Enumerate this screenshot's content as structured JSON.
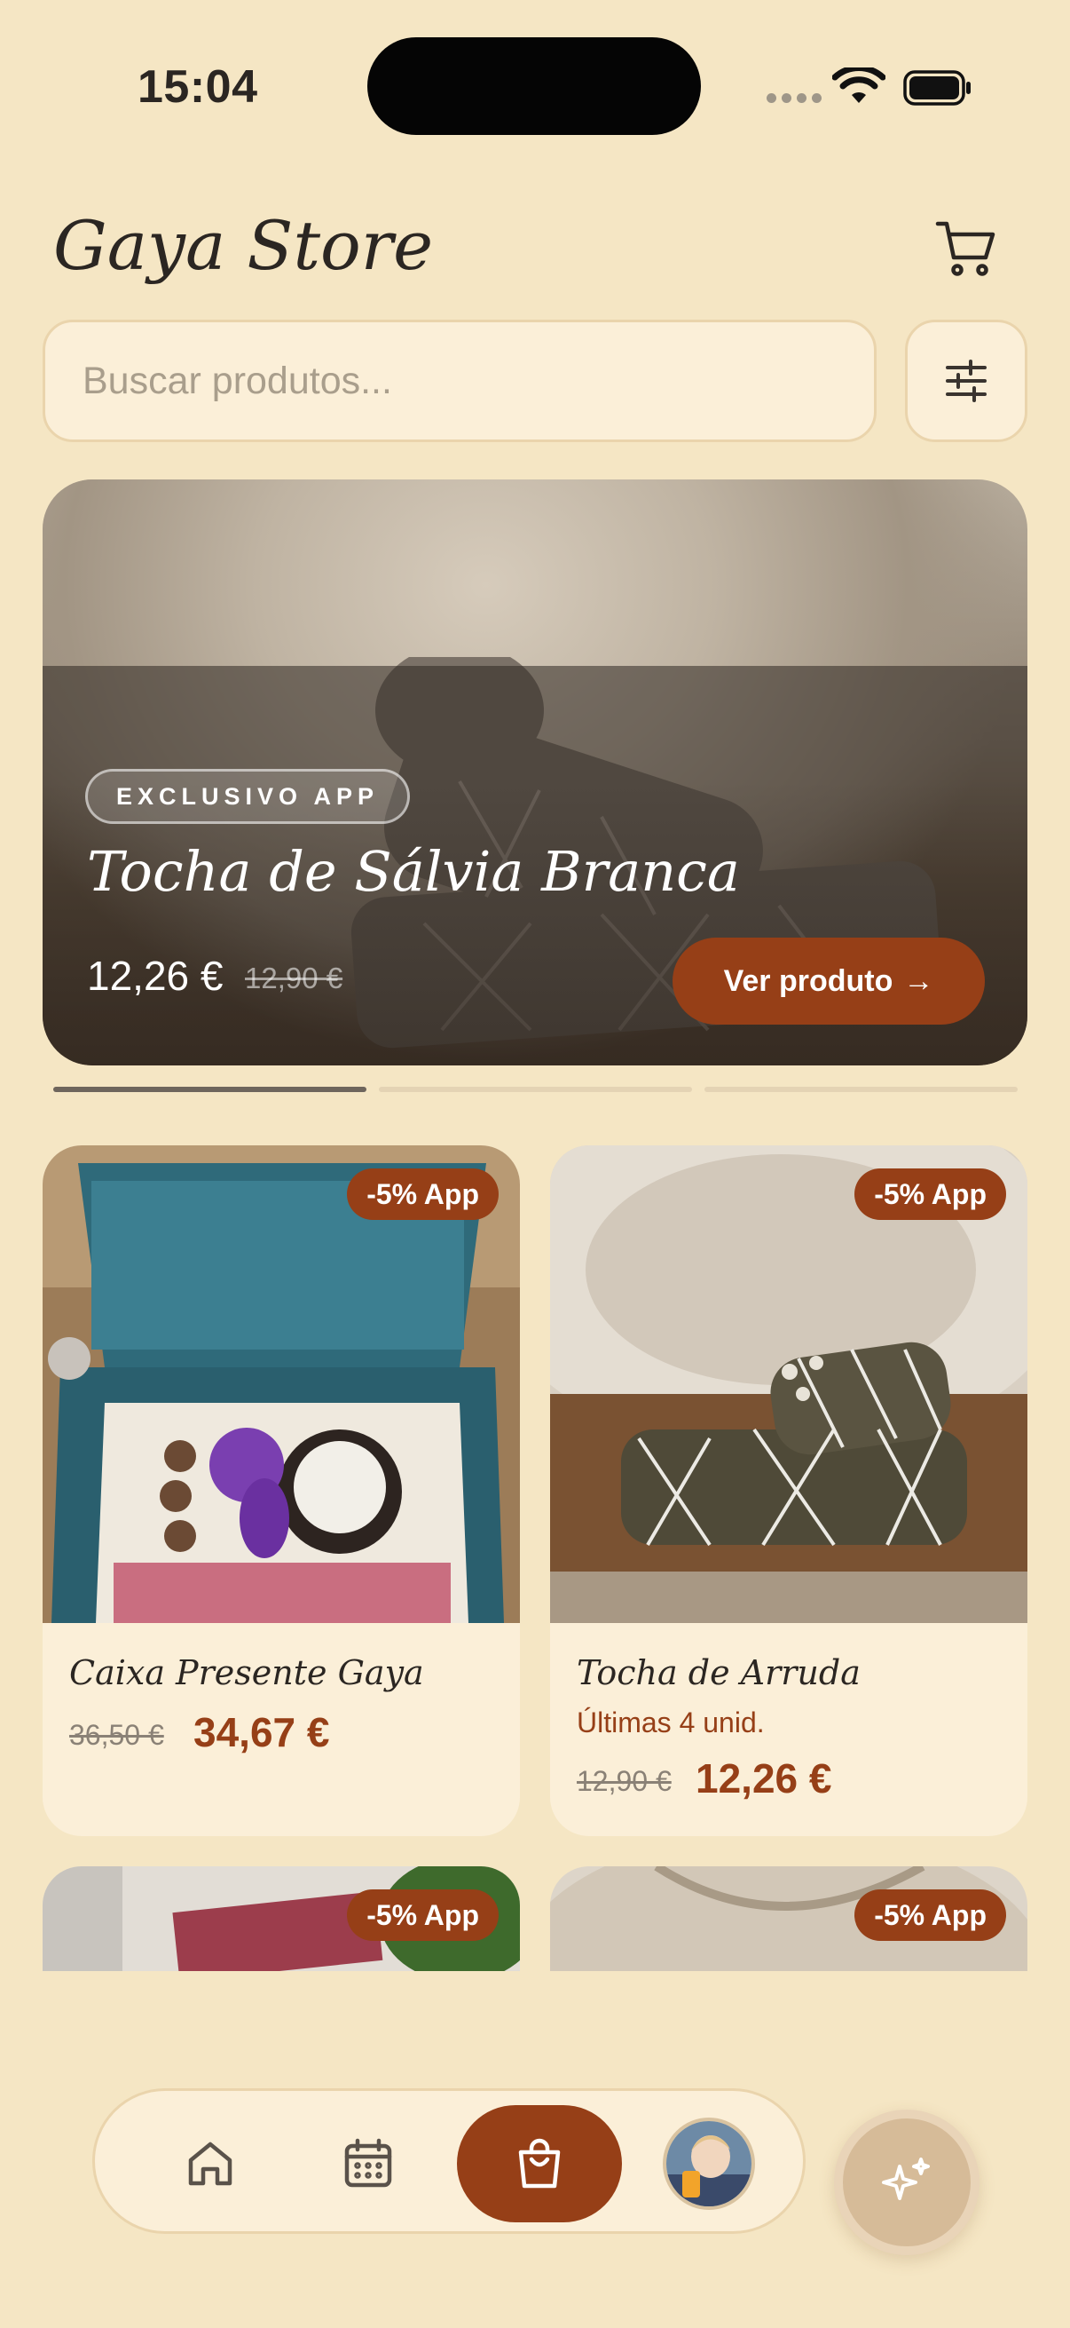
{
  "status_bar": {
    "time": "15:04"
  },
  "header": {
    "title": "Gaya Store"
  },
  "search": {
    "placeholder": "Buscar produtos..."
  },
  "hero": {
    "badge": "EXCLUSIVO APP",
    "title": "Tocha de Sálvia Branca",
    "price": "12,26 €",
    "old_price": "12,90 €",
    "cta_label": "Ver produto",
    "cta_arrow": "→"
  },
  "pager": {
    "pages": 3,
    "active": 1
  },
  "products": [
    {
      "badge": "-5% App",
      "name": "Caixa Presente Gaya",
      "stock": "",
      "old_price": "36,50 €",
      "price": "34,67 €"
    },
    {
      "badge": "-5% App",
      "name": "Tocha de Arruda",
      "stock": "Últimas 4 unid.",
      "old_price": "12,90 €",
      "price": "12,26 €"
    },
    {
      "badge": "-5% App"
    },
    {
      "badge": "-5% App"
    }
  ],
  "nav": {
    "active": "shop"
  },
  "colors": {
    "background": "#f5e6c4",
    "accent": "#963f17",
    "card": "#fbefd8"
  },
  "icons": [
    "wifi-icon",
    "battery-icon",
    "cart-icon",
    "filter-icon",
    "home-icon",
    "calendar-icon",
    "shopping-bag-icon",
    "sparkles-icon"
  ]
}
